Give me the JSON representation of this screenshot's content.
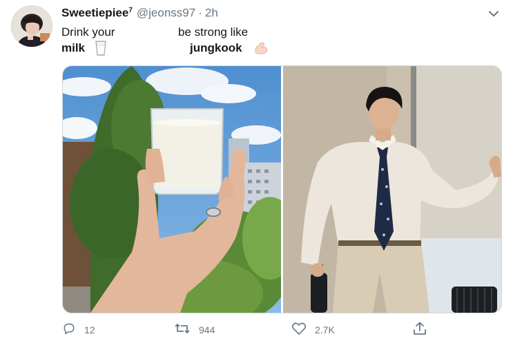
{
  "tweet": {
    "display_name": "Sweetiepiee",
    "name_superscript": "7",
    "handle": "@jeonss97",
    "separator": "·",
    "time": "2h",
    "line1_left": "Drink your",
    "line1_right": "be strong like",
    "line2_left": "milk",
    "line2_right": "jungkook"
  },
  "icons": {
    "glass": "glass-of-milk-icon",
    "muscle": "flexed-biceps-icon",
    "caret": "chevron-down-icon",
    "reply": "reply-icon",
    "retweet": "retweet-icon",
    "like": "like-heart-icon",
    "share": "share-icon"
  },
  "actions": {
    "reply_count": "12",
    "retweet_count": "944",
    "like_count": "2.7K"
  },
  "colors": {
    "secondary_text": "#657786",
    "sky": "#5b9ad6",
    "milk": "#f3f1e6"
  }
}
